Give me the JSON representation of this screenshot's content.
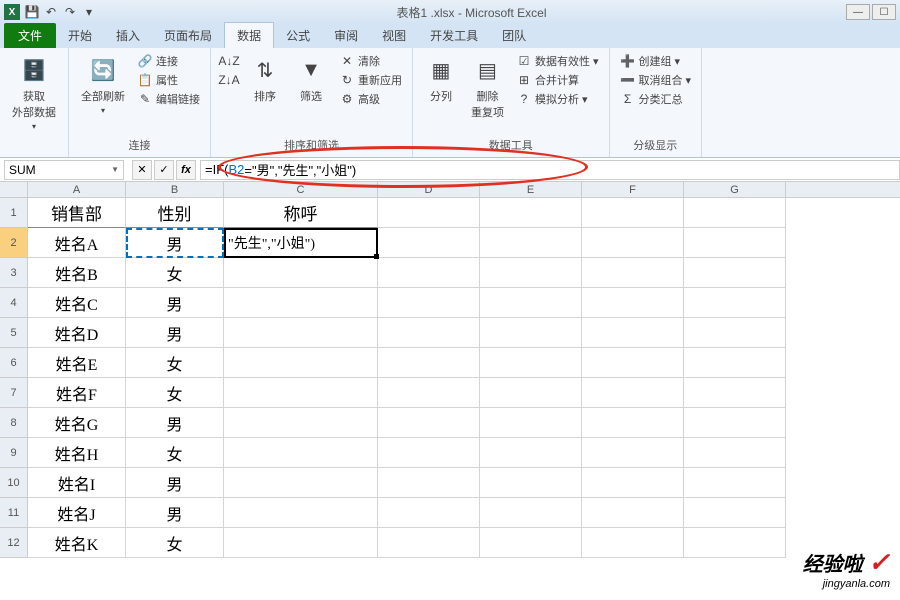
{
  "title": "表格1 .xlsx - Microsoft Excel",
  "qat": {
    "save": "💾",
    "undo": "↶",
    "redo": "↷"
  },
  "tabs": {
    "file": "文件",
    "items": [
      "开始",
      "插入",
      "页面布局",
      "数据",
      "公式",
      "审阅",
      "视图",
      "开发工具",
      "团队"
    ],
    "active": 3
  },
  "ribbon": {
    "g1": {
      "btn": "获取\n外部数据",
      "label": ""
    },
    "g2": {
      "btn": "全部刷新",
      "s1": "连接",
      "s2": "属性",
      "s3": "编辑链接",
      "label": "连接"
    },
    "g3": {
      "sort_asc": "A↓Z",
      "sort_desc": "Z↓A",
      "sort": "排序",
      "filter": "筛选",
      "clear": "清除",
      "reapply": "重新应用",
      "adv": "高级",
      "label": "排序和筛选"
    },
    "g4": {
      "split": "分列",
      "dedupe": "删除\n重复项",
      "valid": "数据有效性",
      "merge": "合并计算",
      "whatif": "模拟分析",
      "label": "数据工具"
    },
    "g5": {
      "group": "创建组",
      "ungroup": "取消组合",
      "subtotal": "分类汇总",
      "label": "分级显示"
    }
  },
  "namebox": "SUM",
  "formula_pre": "=IF(",
  "formula_ref": "B2",
  "formula_post": "=\"男\",\"先生\",\"小姐\")",
  "columns": [
    "A",
    "B",
    "C",
    "D",
    "E",
    "F",
    "G"
  ],
  "header": {
    "A": "销售部",
    "B": "性别",
    "C": "称呼"
  },
  "c2_display": "\"先生\",\"小姐\")",
  "rows": [
    {
      "n": "1"
    },
    {
      "n": "2",
      "A": "姓名A",
      "B": "男"
    },
    {
      "n": "3",
      "A": "姓名B",
      "B": "女"
    },
    {
      "n": "4",
      "A": "姓名C",
      "B": "男"
    },
    {
      "n": "5",
      "A": "姓名D",
      "B": "男"
    },
    {
      "n": "6",
      "A": "姓名E",
      "B": "女"
    },
    {
      "n": "7",
      "A": "姓名F",
      "B": "女"
    },
    {
      "n": "8",
      "A": "姓名G",
      "B": "男"
    },
    {
      "n": "9",
      "A": "姓名H",
      "B": "女"
    },
    {
      "n": "10",
      "A": "姓名I",
      "B": "男"
    },
    {
      "n": "11",
      "A": "姓名J",
      "B": "男"
    },
    {
      "n": "12",
      "A": "姓名K",
      "B": "女"
    }
  ],
  "watermark": {
    "l1": "经验啦",
    "l2": "jingyanla.com"
  }
}
